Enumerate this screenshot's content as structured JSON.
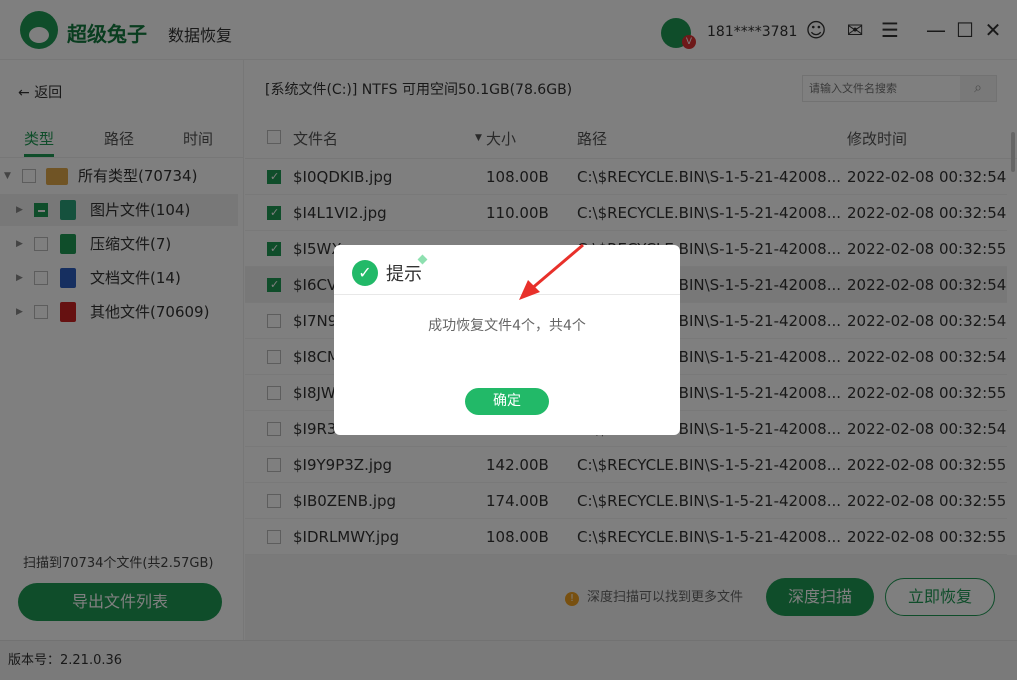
{
  "app": {
    "brand": "超级兔子",
    "subtitle": "数据恢复",
    "user": "181****3781",
    "vip_badge": "V"
  },
  "titlebar_icons": [
    "support-icon",
    "feedback-icon",
    "menu-icon",
    "minimize-icon",
    "maximize-icon",
    "close-icon"
  ],
  "sidebar": {
    "back_label": "返回",
    "tabs": [
      {
        "label": "类型",
        "active": true
      },
      {
        "label": "路径"
      },
      {
        "label": "时间"
      }
    ],
    "tree": [
      {
        "label": "所有类型(70734)",
        "icon": "folder-icon",
        "check": "none",
        "expanded": true
      },
      {
        "label": "图片文件(104)",
        "icon": "image-file-icon",
        "check": "partial",
        "selected": true
      },
      {
        "label": "压缩文件(7)",
        "icon": "zip-file-icon",
        "check": "none"
      },
      {
        "label": "文档文件(14)",
        "icon": "document-file-icon",
        "check": "none"
      },
      {
        "label": "其他文件(70609)",
        "icon": "other-file-icon",
        "check": "none"
      }
    ],
    "scan_info": "扫描到70734个文件(共2.57GB)",
    "export_label": "导出文件列表"
  },
  "main": {
    "path_info": "[系统文件(C:)] NTFS 可用空间50.1GB(78.6GB)",
    "search_placeholder": "请输入文件名搜索",
    "columns": {
      "name": "文件名",
      "size": "大小",
      "path": "路径",
      "time": "修改时间"
    },
    "rows": [
      {
        "name": "$I0QDKIB.jpg",
        "size": "108.00B",
        "path": "C:\\$RECYCLE.BIN\\S-1-5-21-42008...",
        "time": "2022-02-08 00:32:54",
        "checked": true
      },
      {
        "name": "$I4L1VI2.jpg",
        "size": "110.00B",
        "path": "C:\\$RECYCLE.BIN\\S-1-5-21-42008...",
        "time": "2022-02-08 00:32:54",
        "checked": true
      },
      {
        "name": "$I5WX",
        "size": "",
        "path": "C:\\$RECYCLE.BIN\\S-1-5-21-42008...",
        "time": "2022-02-08 00:32:55",
        "checked": true
      },
      {
        "name": "$I6CV",
        "size": "",
        "path": "C:\\$RECYCLE.BIN\\S-1-5-21-42008...",
        "time": "2022-02-08 00:32:54",
        "checked": true,
        "highlight": true
      },
      {
        "name": "$I7N9",
        "size": "",
        "path": "C:\\$RECYCLE.BIN\\S-1-5-21-42008...",
        "time": "2022-02-08 00:32:54",
        "checked": false
      },
      {
        "name": "$I8CM",
        "size": "",
        "path": "C:\\$RECYCLE.BIN\\S-1-5-21-42008...",
        "time": "2022-02-08 00:32:54",
        "checked": false
      },
      {
        "name": "$I8JW",
        "size": "",
        "path": "C:\\$RECYCLE.BIN\\S-1-5-21-42008...",
        "time": "2022-02-08 00:32:55",
        "checked": false
      },
      {
        "name": "$I9R3",
        "size": "",
        "path": "C:\\$RECYCLE.BIN\\S-1-5-21-42008...",
        "time": "2022-02-08 00:32:54",
        "checked": false
      },
      {
        "name": "$I9Y9P3Z.jpg",
        "size": "142.00B",
        "path": "C:\\$RECYCLE.BIN\\S-1-5-21-42008...",
        "time": "2022-02-08 00:32:55",
        "checked": false
      },
      {
        "name": "$IB0ZENB.jpg",
        "size": "174.00B",
        "path": "C:\\$RECYCLE.BIN\\S-1-5-21-42008...",
        "time": "2022-02-08 00:32:55",
        "checked": false
      },
      {
        "name": "$IDRLMWY.jpg",
        "size": "108.00B",
        "path": "C:\\$RECYCLE.BIN\\S-1-5-21-42008...",
        "time": "2022-02-08 00:32:55",
        "checked": false
      }
    ],
    "tip": "深度扫描可以找到更多文件",
    "deep_scan_label": "深度扫描",
    "recover_label": "立即恢复"
  },
  "status": {
    "version": "版本号：2.21.0.36"
  },
  "dialog": {
    "title": "提示",
    "message": "成功恢复文件4个，共4个",
    "ok_label": "确定"
  },
  "colors": {
    "accent": "#1f9a55",
    "dialog_green": "#22b968",
    "arrow": "#e8302a"
  }
}
